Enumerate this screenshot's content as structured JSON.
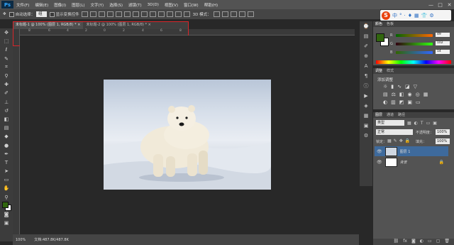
{
  "app": {
    "logo": "Ps"
  },
  "menu": [
    "文件(F)",
    "编辑(E)",
    "图像(I)",
    "图层(L)",
    "文字(Y)",
    "选择(S)",
    "滤镜(T)",
    "3D(D)",
    "视图(V)",
    "窗口(W)",
    "帮助(H)"
  ],
  "window_controls": [
    "—",
    "□",
    "✕"
  ],
  "options": {
    "auto_select_label": "自动选择：",
    "auto_select_value": "组",
    "show_transform_label": "显示变换控件",
    "mode3d_label": "3D 模式："
  },
  "sogou": {
    "logo": "S",
    "items": [
      "中",
      "°",
      "·",
      "♦",
      "▦",
      "👕",
      "⚙"
    ]
  },
  "tabs": [
    {
      "label": "未标题-1 @ 100% (图层 1, RGB/8) *",
      "close": "×"
    },
    {
      "label": "未标题-2 @ 100% (图层 1, RGB/8) *",
      "close": "×"
    }
  ],
  "ruler": {
    "ticks": [
      "8",
      "6",
      "4",
      "2",
      "0",
      "2",
      "4",
      "6",
      "8"
    ]
  },
  "status": {
    "zoom": "100%",
    "doc": "文档:487.8K/487.8K"
  },
  "color_panel": {
    "tabs": [
      "颜色",
      "色板"
    ],
    "channels": [
      {
        "name": "R",
        "value": "49"
      },
      {
        "name": "G",
        "value": "102"
      },
      {
        "name": "B",
        "value": "14"
      }
    ],
    "fg_color": "#31660e"
  },
  "adjust_panel": {
    "tabs": [
      "调整",
      "样式"
    ],
    "title": "添加调整"
  },
  "layers_panel": {
    "tabs": [
      "图层",
      "通道",
      "路径"
    ],
    "kind": "类型",
    "blend_mode": "正常",
    "opacity_label": "不透明度：",
    "opacity": "100%",
    "lock_label": "锁定：",
    "fill_label": "填充：",
    "fill": "100%",
    "layers": [
      {
        "name": "图层 1",
        "selected": true
      },
      {
        "name": "背景",
        "selected": false
      }
    ]
  }
}
